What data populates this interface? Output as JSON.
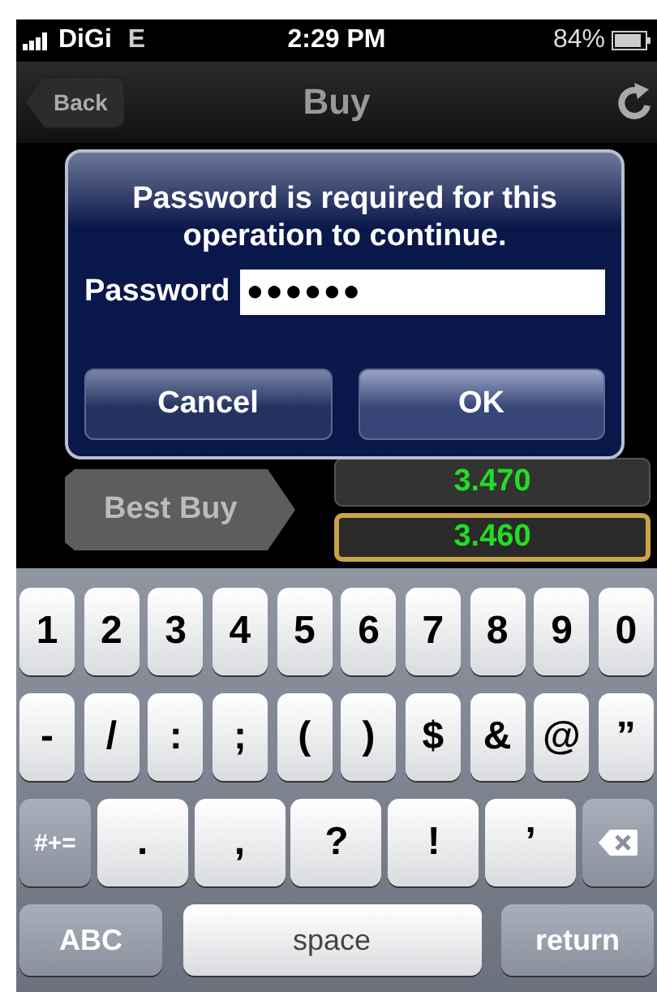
{
  "status_bar": {
    "carrier": "DiGi",
    "network": "E",
    "time": "2:29 PM",
    "battery": "84%"
  },
  "nav_bar": {
    "back": "Back",
    "title": "Buy"
  },
  "best_buy": {
    "label": "Best Buy",
    "prices": [
      "3.470",
      "3.460"
    ]
  },
  "dialog": {
    "message": "Password is required for this operation to continue.",
    "field_label": "Password",
    "value": "●●●●●●",
    "buttons": [
      "Cancel",
      "OK"
    ]
  },
  "keyboard": {
    "number_row": [
      {
        "kind": "char",
        "label": "1"
      },
      {
        "kind": "char",
        "label": "2"
      },
      {
        "kind": "char",
        "label": "3"
      },
      {
        "kind": "char",
        "label": "4"
      },
      {
        "kind": "char",
        "label": "5"
      },
      {
        "kind": "char",
        "label": "6"
      },
      {
        "kind": "char",
        "label": "7"
      },
      {
        "kind": "char",
        "label": "8"
      },
      {
        "kind": "char",
        "label": "9"
      },
      {
        "kind": "char",
        "label": "0"
      }
    ],
    "symbol_row": [
      {
        "kind": "char",
        "label": "-"
      },
      {
        "kind": "char",
        "label": "/"
      },
      {
        "kind": "char",
        "label": ":"
      },
      {
        "kind": "char",
        "label": ";"
      },
      {
        "kind": "char",
        "label": "("
      },
      {
        "kind": "char",
        "label": ")"
      },
      {
        "kind": "char",
        "label": "$"
      },
      {
        "kind": "char",
        "label": "&"
      },
      {
        "kind": "char",
        "label": "@"
      },
      {
        "kind": "char",
        "label": "”"
      }
    ],
    "punctuation_row": [
      {
        "kind": "shift",
        "label": "#+="
      },
      {
        "kind": "wide",
        "label": "."
      },
      {
        "kind": "wide",
        "label": ","
      },
      {
        "kind": "wide",
        "label": "?"
      },
      {
        "kind": "wide",
        "label": "!"
      },
      {
        "kind": "wide",
        "label": "’"
      },
      {
        "kind": "delete"
      }
    ],
    "bottom_row": [
      {
        "kind": "mode",
        "label": "ABC"
      },
      {
        "kind": "space",
        "label": "space"
      },
      {
        "kind": "return",
        "label": "return"
      }
    ]
  }
}
